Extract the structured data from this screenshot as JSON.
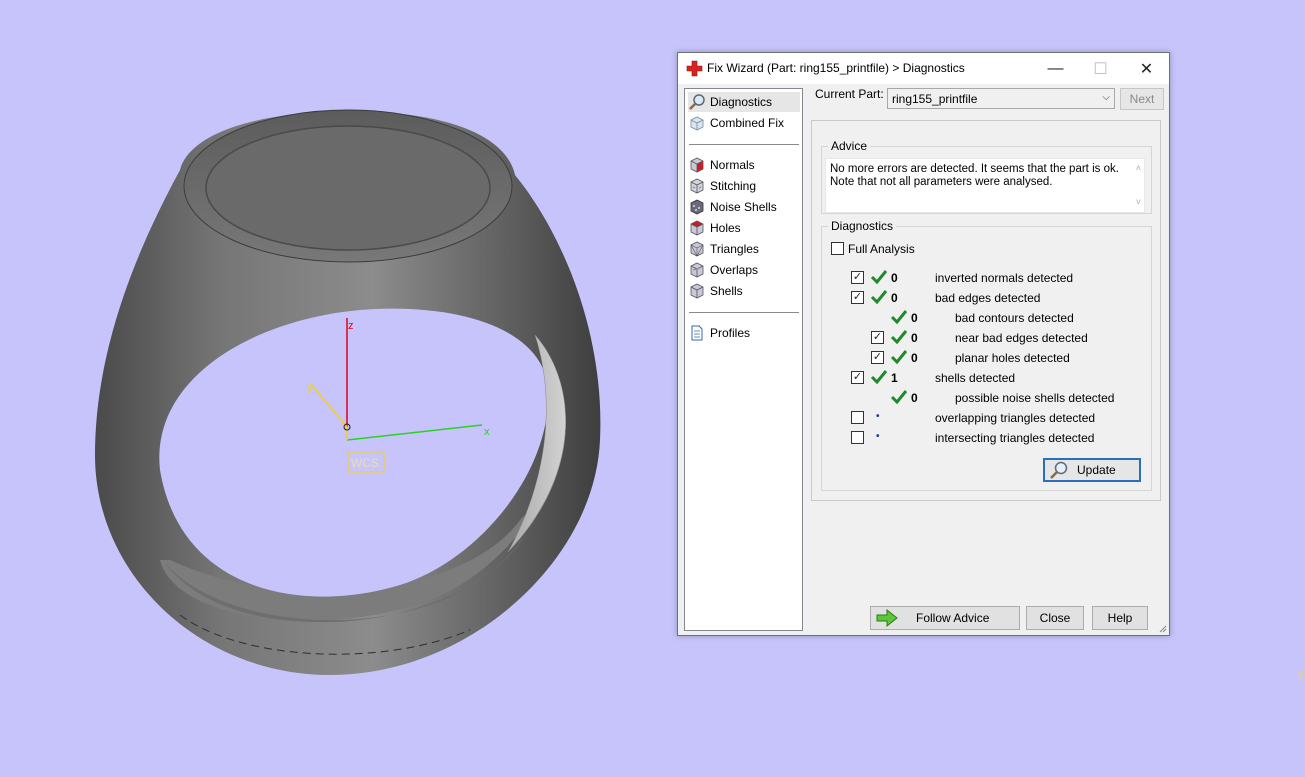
{
  "window": {
    "title": "Fix Wizard (Part: ring155_printfile) > Diagnostics",
    "minimize": "—",
    "maximize": "☐",
    "close": "✕"
  },
  "nav": {
    "items": [
      {
        "label": "Diagnostics",
        "icon": "magnifier-icon"
      },
      {
        "label": "Combined Fix",
        "icon": "combined-fix-icon"
      },
      {
        "label": "Normals",
        "icon": "normals-cube-icon"
      },
      {
        "label": "Stitching",
        "icon": "stitching-cube-icon"
      },
      {
        "label": "Noise Shells",
        "icon": "noise-shells-icon"
      },
      {
        "label": "Holes",
        "icon": "holes-cube-icon"
      },
      {
        "label": "Triangles",
        "icon": "triangles-cube-icon"
      },
      {
        "label": "Overlaps",
        "icon": "overlaps-cube-icon"
      },
      {
        "label": "Shells",
        "icon": "shells-cube-icon"
      },
      {
        "label": "Profiles",
        "icon": "document-icon"
      }
    ]
  },
  "current_part": {
    "label": "Current Part:",
    "value": "ring155_printfile",
    "next_label": "Next"
  },
  "advice": {
    "title": "Advice",
    "line1": "No more errors are detected. It seems that the part is ok.",
    "line2": "Note that not all parameters were analysed."
  },
  "diagnostics": {
    "title": "Diagnostics",
    "full_analysis_label": "Full Analysis",
    "rows": [
      {
        "checked": "✓",
        "count": "0",
        "label": "inverted normals detected"
      },
      {
        "checked": "✓",
        "count": "0",
        "label": "bad edges detected"
      },
      {
        "count": "0",
        "label": "bad contours detected"
      },
      {
        "checked": "✓",
        "count": "0",
        "label": "near bad edges detected"
      },
      {
        "checked": "✓",
        "count": "0",
        "label": "planar holes detected"
      },
      {
        "checked": "✓",
        "count": "1",
        "label": "shells detected"
      },
      {
        "count": "0",
        "label": "possible noise shells detected"
      },
      {
        "checked": "",
        "marker": "•",
        "label": "overlapping triangles detected"
      },
      {
        "checked": "",
        "marker": "•",
        "label": "intersecting triangles detected"
      }
    ],
    "update_label": "Update"
  },
  "buttons": {
    "follow_advice": "Follow Advice",
    "close": "Close",
    "help": "Help"
  },
  "viewport": {
    "axis_z": "z",
    "axis_y": "y",
    "axis_x": "x",
    "wcs_label": "WCS",
    "corner_mark": "Y"
  },
  "colors": {
    "viewport_bg": "#c6c4fb",
    "check_green": "#1f8a2a",
    "axis_z": "#e0001a",
    "axis_y": "#f2d21b",
    "axis_x": "#2bd21e"
  }
}
